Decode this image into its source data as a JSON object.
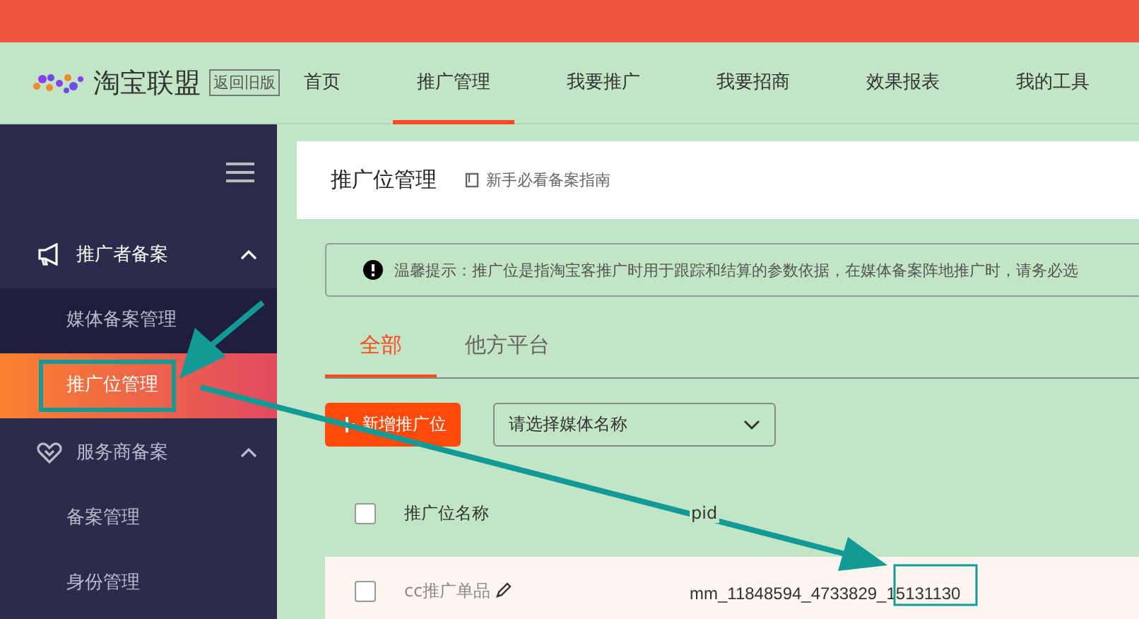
{
  "header": {
    "logo": "淘宝联盟",
    "old_version_button": "返回旧版",
    "nav": [
      {
        "label": "首页",
        "selected": false
      },
      {
        "label": "推广管理",
        "selected": true
      },
      {
        "label": "我要推广",
        "selected": false
      },
      {
        "label": "我要招商",
        "selected": false
      },
      {
        "label": "效果报表",
        "selected": false
      },
      {
        "label": "我的工具",
        "selected": false
      }
    ]
  },
  "sidebar": {
    "groups": [
      {
        "label": "推广者备案",
        "kind": "megaphone",
        "expanded": true,
        "children": [
          {
            "label": "媒体备案管理",
            "selected": false
          },
          {
            "label": "推广位管理",
            "selected": true
          }
        ]
      },
      {
        "label": "服务商备案",
        "kind": "handshake",
        "expanded": true,
        "children": [
          {
            "label": "备案管理",
            "selected": false
          },
          {
            "label": "身份管理",
            "selected": false
          }
        ]
      }
    ]
  },
  "page": {
    "title": "推广位管理",
    "guide_link": "新手必看备案指南",
    "notice": "温馨提示：推广位是指淘宝客推广时用于跟踪和结算的参数依据，在媒体备案阵地推广时，请务必选",
    "tabs": [
      {
        "label": "全部",
        "selected": true
      },
      {
        "label": "他方平台",
        "selected": false
      }
    ],
    "add_button": "新增推广位",
    "media_select": {
      "placeholder": "请选择媒体名称"
    },
    "table": {
      "select_all_checked": false,
      "columns": [
        "推广位名称",
        "pid"
      ],
      "rows": [
        {
          "checked": false,
          "name": "cc推广单品",
          "pid": "mm_11848594_4733829_15131130"
        }
      ]
    }
  }
}
